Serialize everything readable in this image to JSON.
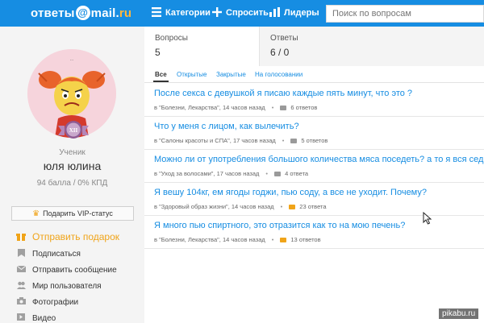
{
  "header": {
    "logo": {
      "part1": "ответы",
      "at": "@",
      "part2": "mail",
      "dot": ".",
      "ru": "ru"
    },
    "nav": [
      {
        "label": "Категории",
        "icon": "grid-icon"
      },
      {
        "label": "Спросить",
        "icon": "plus-icon"
      },
      {
        "label": "Лидеры",
        "icon": "bar-chart-icon"
      }
    ],
    "search_placeholder": "Поиск по вопросам",
    "colors": {
      "bar": "#168de2",
      "accent": "#ffb73d"
    }
  },
  "profile": {
    "badge_text": "XII",
    "rank": "Ученик",
    "name": "юля юлина",
    "stats": "94 балла / 0% КПД",
    "vip_button": "Подарить VIP-статус",
    "menu": [
      {
        "label": "Отправить подарок",
        "icon": "gift-icon"
      },
      {
        "label": "Подписаться",
        "icon": "bookmark-icon"
      },
      {
        "label": "Отправить сообщение",
        "icon": "envelope-icon"
      },
      {
        "label": "Мир пользователя",
        "icon": "people-icon"
      },
      {
        "label": "Фотографии",
        "icon": "camera-icon"
      },
      {
        "label": "Видео",
        "icon": "video-icon"
      }
    ]
  },
  "tabs": [
    {
      "label": "Вопросы",
      "value": "5"
    },
    {
      "label": "Ответы",
      "value": "6 / 0"
    }
  ],
  "filters": [
    "Все",
    "Открытые",
    "Закрытые",
    "На голосовании"
  ],
  "questions": [
    {
      "title": "После секса с девушкой я писаю каждые пять минут, что это ?",
      "category": "в \"Болезни, Лекарства\"",
      "time": "14 часов назад",
      "answers": "6 ответов",
      "hot": false
    },
    {
      "title": "Что у меня с лицом, как вылечить?",
      "category": "в \"Салоны красоты и СПА\"",
      "time": "17 часов назад",
      "answers": "5 ответов",
      "hot": false
    },
    {
      "title": "Можно ли от употребления большого количества мяса поседеть? а то я вся седая",
      "category": "в \"Уход за волосами\"",
      "time": "17 часов назад",
      "answers": "4 ответа",
      "hot": false
    },
    {
      "title": "Я вешу 104кг, ем ягоды годжи, пью соду, а все не уходит. Почему?",
      "category": "в \"Здоровый образ жизни\"",
      "time": "14 часов назад",
      "answers": "23 ответа",
      "hot": true
    },
    {
      "title": "Я много пью спиртного, это отразится как то на мою печень?",
      "category": "в \"Болезни, Лекарства\"",
      "time": "14 часов назад",
      "answers": "13 ответов",
      "hot": true
    }
  ],
  "watermark": "pikabu.ru"
}
